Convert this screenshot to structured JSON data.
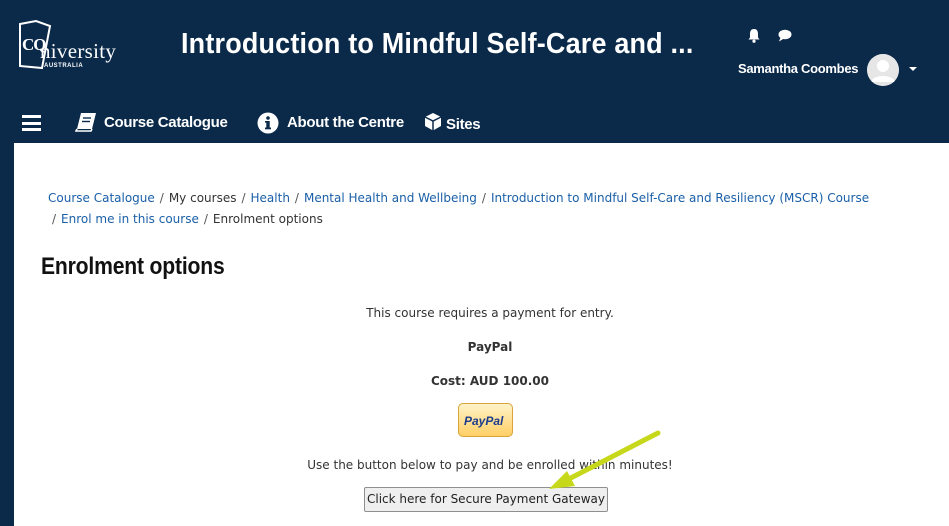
{
  "header": {
    "logo_text": "CQUniversity",
    "logo_subtext": "AUSTRALIA",
    "course_title": "Introduction to Mindful Self-Care and ...",
    "user_name": "Samantha Coombes",
    "icons": [
      "bell-icon",
      "chat-icon",
      "avatar",
      "caret-down-icon"
    ],
    "brand_color": "#0b2a4a"
  },
  "nav": {
    "items": [
      {
        "label": "Course Catalogue",
        "icon": "book-icon"
      },
      {
        "label": "About the Centre",
        "icon": "info-icon"
      },
      {
        "label": "Sites",
        "icon": "cube-icon"
      }
    ]
  },
  "breadcrumb": {
    "items": [
      "Course Catalogue",
      "My courses",
      "Health",
      "Mental Health and Wellbeing",
      "Introduction to Mindful Self-Care and Resiliency (MSCR) Course",
      "Enrol me in this course",
      "Enrolment options"
    ],
    "separator": "/"
  },
  "main": {
    "heading": "Enrolment options",
    "payment_required": "This course requires a payment for entry.",
    "method": "PayPal",
    "cost": "Cost: AUD 100.00",
    "paypal_logo": "PayPal",
    "instruction": "Use the button below to pay and be enrolled within minutes!",
    "pay_button_label": "Click here for Secure Payment Gateway"
  },
  "annotation": {
    "arrow_color": "#c7d81a"
  }
}
